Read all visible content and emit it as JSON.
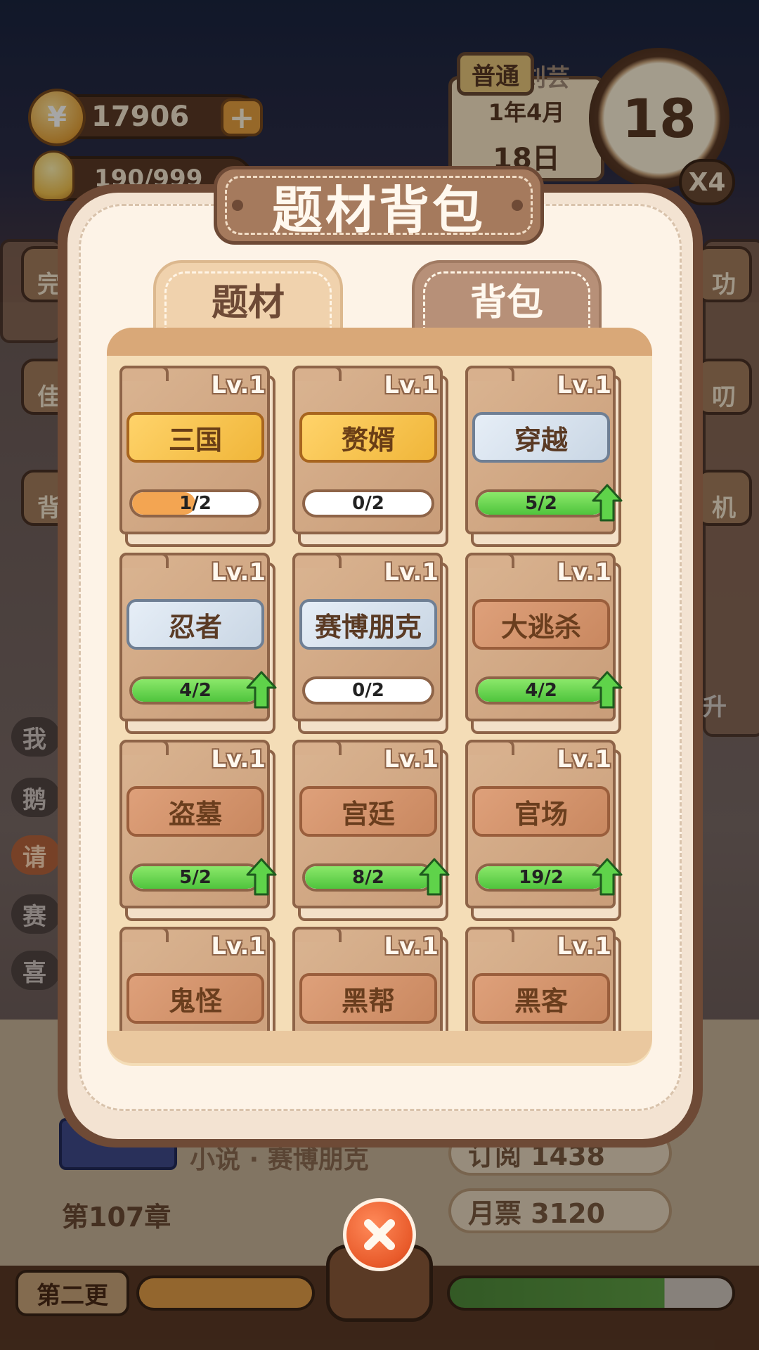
{
  "hud": {
    "coins": "17906",
    "coin_symbol": "¥",
    "plus_label": "+",
    "inspiration": "190/999"
  },
  "calendar": {
    "difficulty": "普通",
    "month": "1年4月",
    "day": "18日",
    "behind_text": "刘芸"
  },
  "clock": {
    "hour": "18",
    "speed": "X4"
  },
  "side_left": [
    "我",
    "鹅",
    "请",
    "赛",
    "喜"
  ],
  "side_left_upper": [
    "完",
    "佳",
    "背"
  ],
  "side_right": [
    "功",
    "叨",
    "机",
    "升"
  ],
  "bottom": {
    "chapter": "第107章",
    "book_subtitle": "小说 · 赛博朋克",
    "subscribe": "订阅 1438",
    "monthly_ticket": "月票 3120",
    "update_button": "第二更",
    "typewriter_progress": 0.75
  },
  "modal": {
    "title": "题材背包",
    "tabs": [
      {
        "label": "题材",
        "active": true
      },
      {
        "label": "背包",
        "active": false
      }
    ],
    "cards": [
      {
        "level": "Lv.1",
        "name": "三国",
        "rarity": "gold",
        "progress": "1/2",
        "fill": 0.5,
        "bar": "orange",
        "upgrade": false
      },
      {
        "level": "Lv.1",
        "name": "赘婿",
        "rarity": "gold",
        "progress": "0/2",
        "fill": 0,
        "bar": "none",
        "upgrade": false
      },
      {
        "level": "Lv.1",
        "name": "穿越",
        "rarity": "silver",
        "progress": "5/2",
        "fill": 1,
        "bar": "green",
        "upgrade": true
      },
      {
        "level": "Lv.1",
        "name": "忍者",
        "rarity": "silver",
        "progress": "4/2",
        "fill": 1,
        "bar": "green",
        "upgrade": true
      },
      {
        "level": "Lv.1",
        "name": "赛博朋克",
        "rarity": "silver",
        "progress": "0/2",
        "fill": 0,
        "bar": "none",
        "upgrade": false
      },
      {
        "level": "Lv.1",
        "name": "大逃杀",
        "rarity": "bronze",
        "progress": "4/2",
        "fill": 1,
        "bar": "green",
        "upgrade": true
      },
      {
        "level": "Lv.1",
        "name": "盗墓",
        "rarity": "bronze",
        "progress": "5/2",
        "fill": 1,
        "bar": "green",
        "upgrade": true
      },
      {
        "level": "Lv.1",
        "name": "宫廷",
        "rarity": "bronze",
        "progress": "8/2",
        "fill": 1,
        "bar": "green",
        "upgrade": true
      },
      {
        "level": "Lv.1",
        "name": "官场",
        "rarity": "bronze",
        "progress": "19/2",
        "fill": 1,
        "bar": "green",
        "upgrade": true
      },
      {
        "level": "Lv.1",
        "name": "鬼怪",
        "rarity": "bronze",
        "progress": "",
        "fill": 0,
        "bar": "none",
        "upgrade": false
      },
      {
        "level": "Lv.1",
        "name": "黑帮",
        "rarity": "bronze",
        "progress": "",
        "fill": 0,
        "bar": "none",
        "upgrade": false
      },
      {
        "level": "Lv.1",
        "name": "黑客",
        "rarity": "bronze",
        "progress": "",
        "fill": 0,
        "bar": "none",
        "upgrade": false
      }
    ]
  },
  "icons": {
    "close": "close-x-icon",
    "upgrade": "green-up-arrow-icon",
    "coin": "coin-icon",
    "inspiration": "lightbulb-icon"
  },
  "colors": {
    "panel_border": "#6e4a36",
    "panel_face": "#fdf3e7",
    "gold_tag": "#f0b63a",
    "silver_tag": "#c9d6e4",
    "bronze_tag": "#c98860",
    "progress_green": "#4fc43d",
    "progress_orange": "#f3a552",
    "close_button": "#e85a2a"
  }
}
